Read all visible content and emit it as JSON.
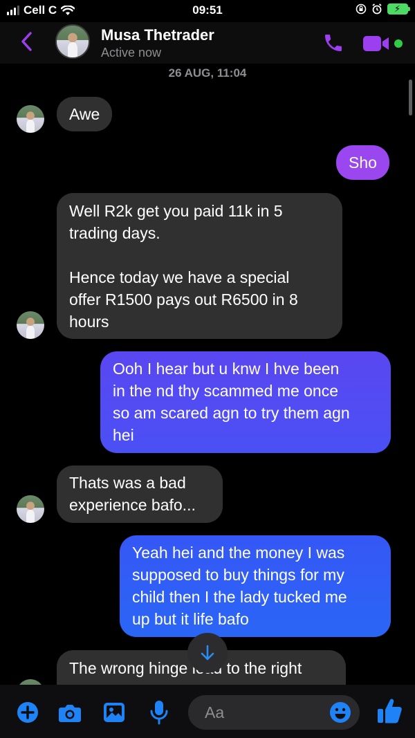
{
  "status_bar": {
    "carrier": "Cell C",
    "time": "09:51"
  },
  "header": {
    "contact_name": "Musa Thetrader",
    "contact_status": "Active now",
    "icons": [
      "back-chevron-icon",
      "phone-icon",
      "video-camera-icon"
    ]
  },
  "chat": {
    "timestamp": "26 AUG, 11:04",
    "messages": [
      {
        "direction": "incoming",
        "text": "Awe"
      },
      {
        "direction": "outgoing",
        "text": "Sho"
      },
      {
        "direction": "incoming",
        "text": "Well R2k get you paid 11k in 5\ntrading days.\n\nHence today we have a special\noffer R1500 pays out R6500 in 8\nhours"
      },
      {
        "direction": "outgoing",
        "text": "Ooh I hear but u knw I hve been\nin the nd thy scammed me once\nso am scared agn to try them agn\nhei"
      },
      {
        "direction": "incoming",
        "text": "Thats was a bad\nexperience bafo..."
      },
      {
        "direction": "outgoing",
        "text": "Yeah hei and the money I was\nsupposed to buy things for my\nchild then I the lady tucked me\nup but it life bafo"
      },
      {
        "direction": "incoming",
        "text": "The wrong hinge lead to the right"
      }
    ]
  },
  "composer": {
    "placeholder": "Aa",
    "icons": [
      "plus-icon",
      "camera-icon",
      "image-icon",
      "microphone-icon",
      "emoji-icon",
      "thumbs-up-icon"
    ]
  },
  "colors": {
    "accent_purple": "#9c3ff0",
    "bubble_incoming": "#303030",
    "bubble_outgoing_blue": "#3d5cf6",
    "composer_blue": "#1e83f6",
    "online_green": "#31cc46"
  }
}
